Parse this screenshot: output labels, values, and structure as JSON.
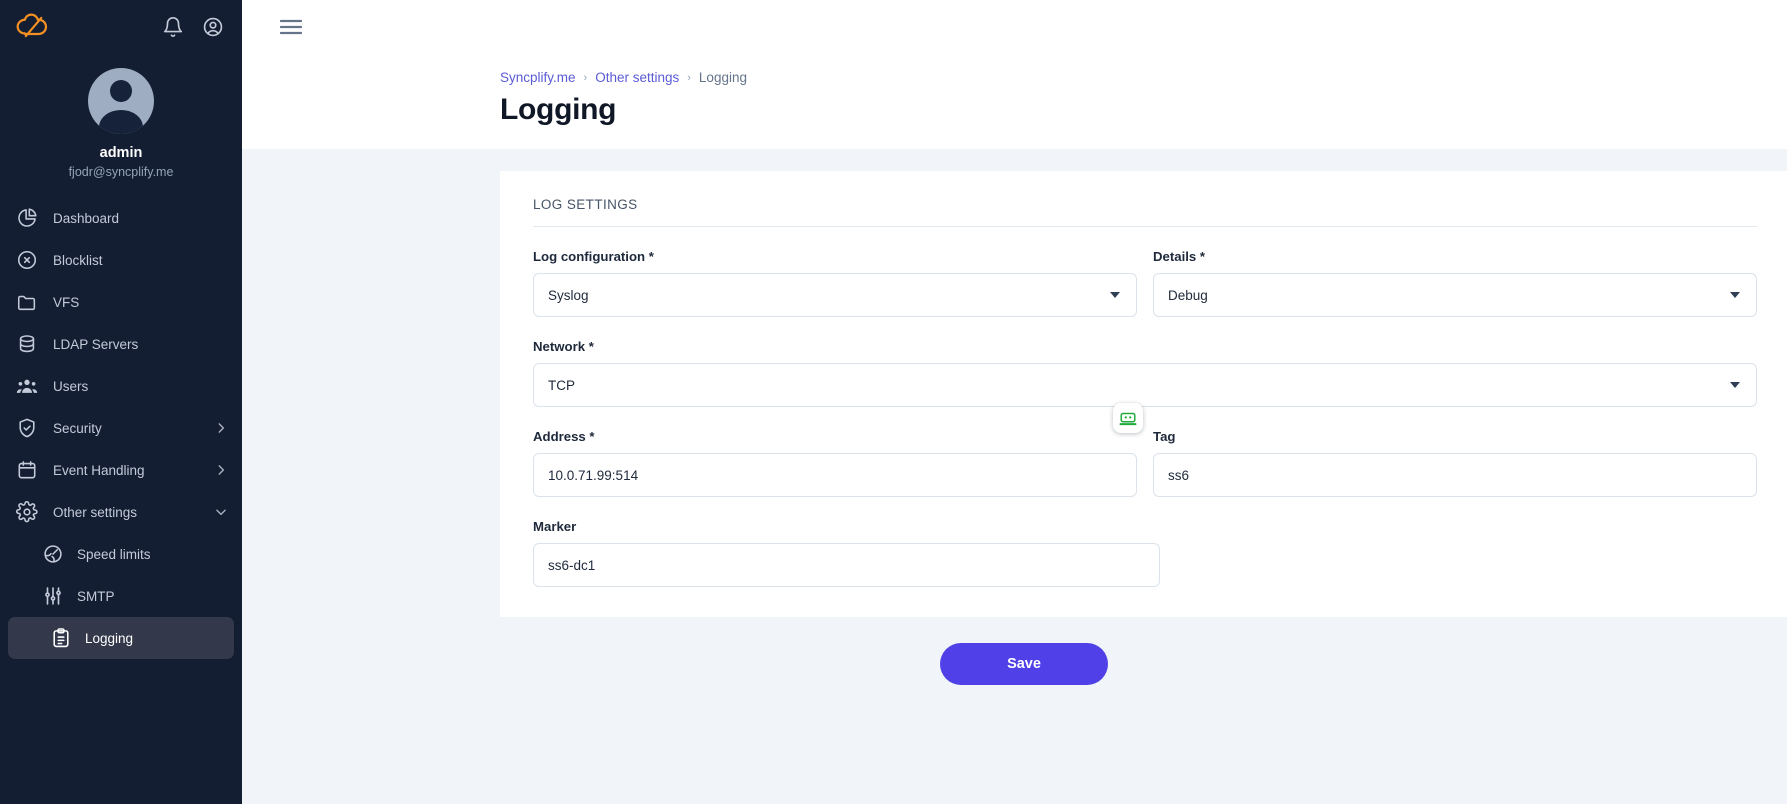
{
  "sidebar": {
    "logo_icon": "syncplify-cloud-logo",
    "logo_color": "#f59022",
    "bell_icon": "notification-bell-icon",
    "account_icon": "user-account-circle-icon",
    "profile": {
      "avatar_icon": "user-avatar",
      "username": "admin",
      "email": "fjodr@syncplify.me"
    },
    "items": [
      {
        "label": "Dashboard",
        "icon": "pie-chart-icon",
        "expandable": false,
        "active": false,
        "sub": false
      },
      {
        "label": "Blocklist",
        "icon": "block-circle-icon",
        "expandable": false,
        "active": false,
        "sub": false
      },
      {
        "label": "VFS",
        "icon": "folder-icon",
        "expandable": false,
        "active": false,
        "sub": false
      },
      {
        "label": "LDAP Servers",
        "icon": "database-icon",
        "expandable": false,
        "active": false,
        "sub": false
      },
      {
        "label": "Users",
        "icon": "users-group-icon",
        "expandable": false,
        "active": false,
        "sub": false
      },
      {
        "label": "Security",
        "icon": "shield-check-icon",
        "expandable": true,
        "active": false,
        "sub": false
      },
      {
        "label": "Event Handling",
        "icon": "calendar-icon",
        "expandable": true,
        "active": false,
        "sub": false
      },
      {
        "label": "Other settings",
        "icon": "gear-icon",
        "expandable": true,
        "active": false,
        "sub": false,
        "expanded": true
      },
      {
        "label": "Speed limits",
        "icon": "globe-speed-icon",
        "expandable": false,
        "active": false,
        "sub": true
      },
      {
        "label": "SMTP",
        "icon": "sliders-icon",
        "expandable": false,
        "active": false,
        "sub": true
      },
      {
        "label": "Logging",
        "icon": "clipboard-list-icon",
        "expandable": false,
        "active": true,
        "sub": true
      }
    ]
  },
  "topbar": {
    "menu_icon": "hamburger-menu-icon"
  },
  "header": {
    "breadcrumb": [
      {
        "label": "Syncplify.me",
        "current": false
      },
      {
        "label": "Other settings",
        "current": false
      },
      {
        "label": "Logging",
        "current": true
      }
    ],
    "separator": "›",
    "title": "Logging"
  },
  "card": {
    "title": "LOG SETTINGS",
    "fields": {
      "log_configuration": {
        "label": "Log configuration *",
        "value": "Syslog",
        "type": "select"
      },
      "details": {
        "label": "Details *",
        "value": "Debug",
        "type": "select"
      },
      "network": {
        "label": "Network *",
        "value": "TCP",
        "type": "select"
      },
      "address": {
        "label": "Address *",
        "value": "10.0.71.99:514",
        "type": "text"
      },
      "tag": {
        "label": "Tag",
        "value": "ss6",
        "type": "text"
      },
      "marker": {
        "label": "Marker",
        "value": "ss6-dc1",
        "type": "text"
      }
    },
    "badge_icon": "green-robot-cursor-icon"
  },
  "footer": {
    "save_label": "Save",
    "save_color": "#4f40e8"
  }
}
